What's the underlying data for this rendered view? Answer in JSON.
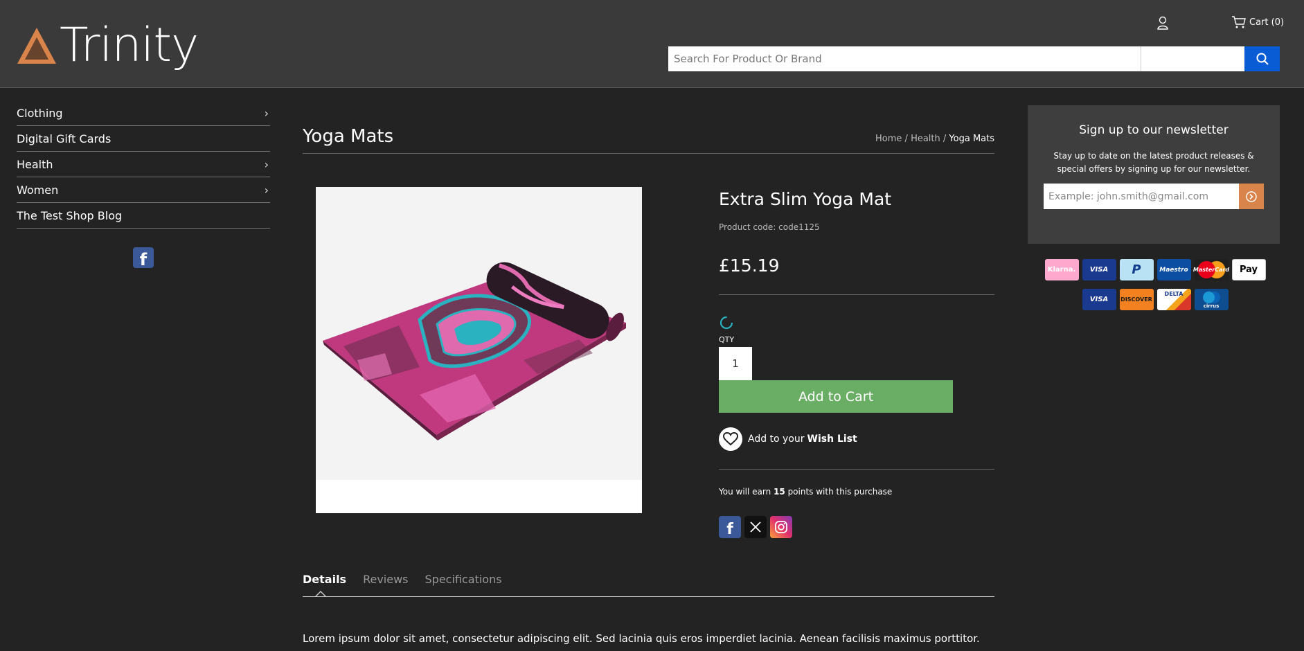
{
  "header": {
    "logo_text": "Trinity",
    "cart_label": "Cart (0)",
    "search_placeholder": "Search For Product Or Brand"
  },
  "sidebar": {
    "items": [
      {
        "label": "Clothing",
        "has_children": true
      },
      {
        "label": "Digital Gift Cards",
        "has_children": false
      },
      {
        "label": "Health",
        "has_children": true
      },
      {
        "label": "Women",
        "has_children": true
      },
      {
        "label": "The Test Shop Blog",
        "has_children": false
      }
    ]
  },
  "page": {
    "title": "Yoga Mats",
    "breadcrumb": {
      "home": "Home",
      "sep1": " / ",
      "health": "Health",
      "sep2": " / ",
      "current": "Yoga Mats"
    }
  },
  "product": {
    "name": "Extra Slim Yoga Mat",
    "code": "Product code: code1125",
    "price": "£15.19",
    "qty_label": "QTY",
    "qty_value": "1",
    "add_to_cart": "Add to Cart",
    "wish_prefix": "Add to your",
    "wish_link": "Wish List",
    "points_prefix": "You will earn",
    "points_value": "15",
    "points_suffix": "points with this purchase"
  },
  "tabs": [
    {
      "label": "Details",
      "active": true
    },
    {
      "label": "Reviews",
      "active": false
    },
    {
      "label": "Specifications",
      "active": false
    }
  ],
  "details_text": "Lorem ipsum dolor sit amet, consectetur adipiscing elit. Sed lacinia quis eros imperdiet lacinia. Aenean facilisis maximus porttitor.",
  "newsletter": {
    "title": "Sign up to our newsletter",
    "text": "Stay up to date on the latest product releases & special offers by signing up for our newsletter.",
    "placeholder": "Example: john.smith@gmail.com"
  },
  "payments": {
    "row1": [
      "Klarna.",
      "VISA",
      "P",
      "Maestro",
      "MasterCard",
      "Pay"
    ],
    "row2": [
      "VISA",
      "DISCOVER",
      "DELTA",
      "cirrus"
    ]
  },
  "colors": {
    "header_bg": "#3a3a3a",
    "page_bg": "#232323",
    "search_button": "#0a5cd5",
    "add_to_cart": "#6aad64",
    "newsletter_button": "#d9844a",
    "logo_copper": "#d9844a"
  }
}
